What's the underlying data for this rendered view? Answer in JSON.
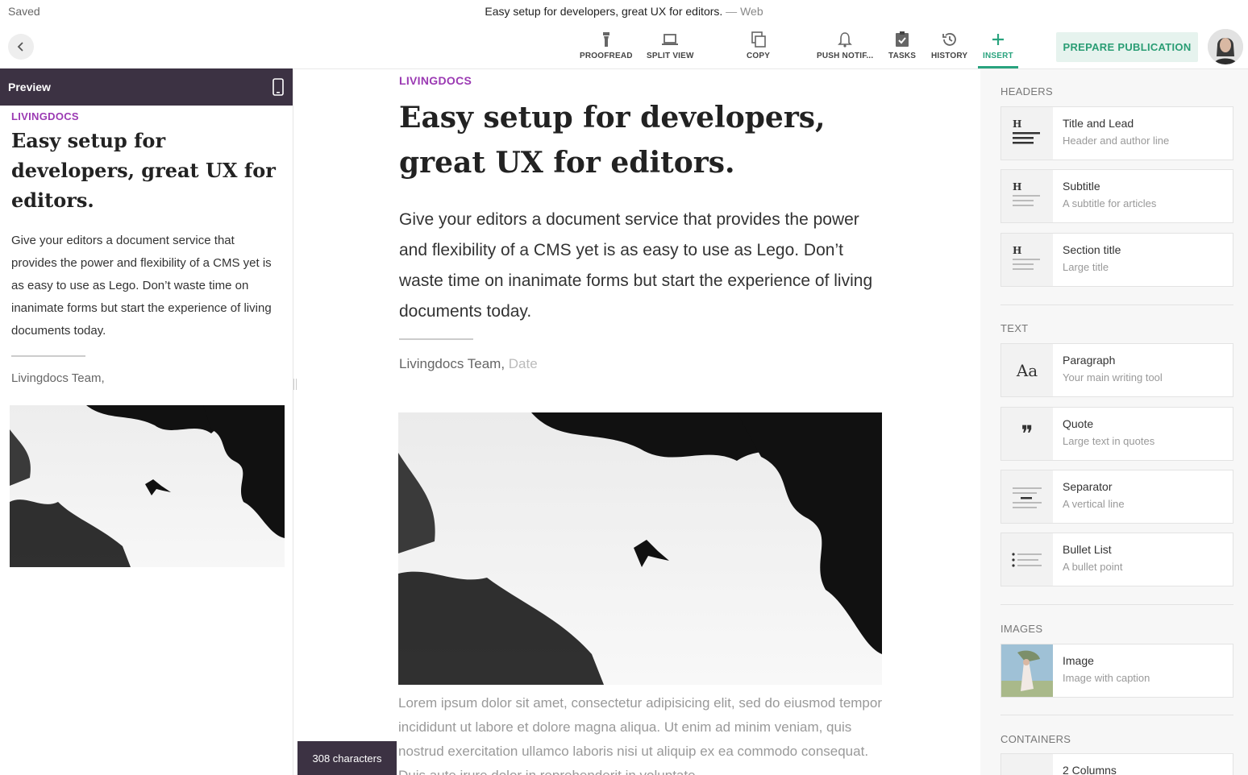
{
  "header": {
    "status": "Saved",
    "title": "Easy setup for developers,  great UX for editors.",
    "dash": " — ",
    "channel": "Web"
  },
  "toolbar": {
    "tools": [
      {
        "label": "PROOFREAD",
        "icon": "flashlight-icon"
      },
      {
        "label": "SPLIT VIEW",
        "icon": "laptop-icon"
      },
      {
        "label": "COPY",
        "icon": "copy-icon"
      },
      {
        "label": "PUSH NOTIF...",
        "icon": "bell-icon"
      },
      {
        "label": "TASKS",
        "icon": "clipboard-check-icon"
      },
      {
        "label": "HISTORY",
        "icon": "history-icon"
      },
      {
        "label": "INSERT",
        "icon": "plus-icon",
        "active": true
      }
    ],
    "prepare_label": "PREPARE PUBLICATION",
    "accent": "#29a37e"
  },
  "preview": {
    "label": "Preview",
    "kicker": "LIVINGDOCS",
    "title": "Easy setup for developers,  great UX for editors.",
    "lead": "Give your editors a document service that provides the power and flexibility of a CMS yet is as easy to use as Lego. Don’t waste time on inanimate forms but start the experience of living documents today.",
    "author": "Livingdocs Team,"
  },
  "editor": {
    "kicker": "LIVINGDOCS",
    "title": "Easy setup for developers,  great UX for editors.",
    "lead": "Give your editors a document service that provides the power and flexibility of a CMS yet is as easy to use as Lego. Don’t waste time on inanimate forms but start the experience of living documents today.",
    "author": "Livingdocs Team,",
    "date_placeholder": "Date",
    "body": "Lorem ipsum dolor sit amet, consectetur adipisicing elit, sed do eiusmod tempor incididunt ut labore et dolore magna aliqua. Ut enim ad minim veniam, quis nostrud exercitation ullamco laboris nisi ut aliquip ex ea commodo consequat. Duis aute irure dolor in reprehenderit in voluptate",
    "char_count": "308 characters"
  },
  "insert_panel": {
    "headers_label": "HEADERS",
    "text_label": "TEXT",
    "images_label": "IMAGES",
    "containers_label": "CONTAINERS",
    "headers": [
      {
        "title": "Title and Lead",
        "sub": "Header and author line"
      },
      {
        "title": "Subtitle",
        "sub": "A subtitle for articles"
      },
      {
        "title": "Section title",
        "sub": "Large title"
      }
    ],
    "text": [
      {
        "title": "Paragraph",
        "sub": "Your main writing tool",
        "glyph": "Aa"
      },
      {
        "title": "Quote",
        "sub": "Large text in quotes",
        "glyph": "❞"
      },
      {
        "title": "Separator",
        "sub": "A vertical line"
      },
      {
        "title": "Bullet List",
        "sub": "A bullet point"
      }
    ],
    "images": [
      {
        "title": "Image",
        "sub": "Image with caption"
      }
    ],
    "containers": [
      {
        "title": "2 Columns"
      }
    ],
    "header_glyph": "H"
  },
  "colors": {
    "kicker": "#9b3ab3",
    "dark_panel": "#3c3243",
    "accent": "#29a37e"
  }
}
